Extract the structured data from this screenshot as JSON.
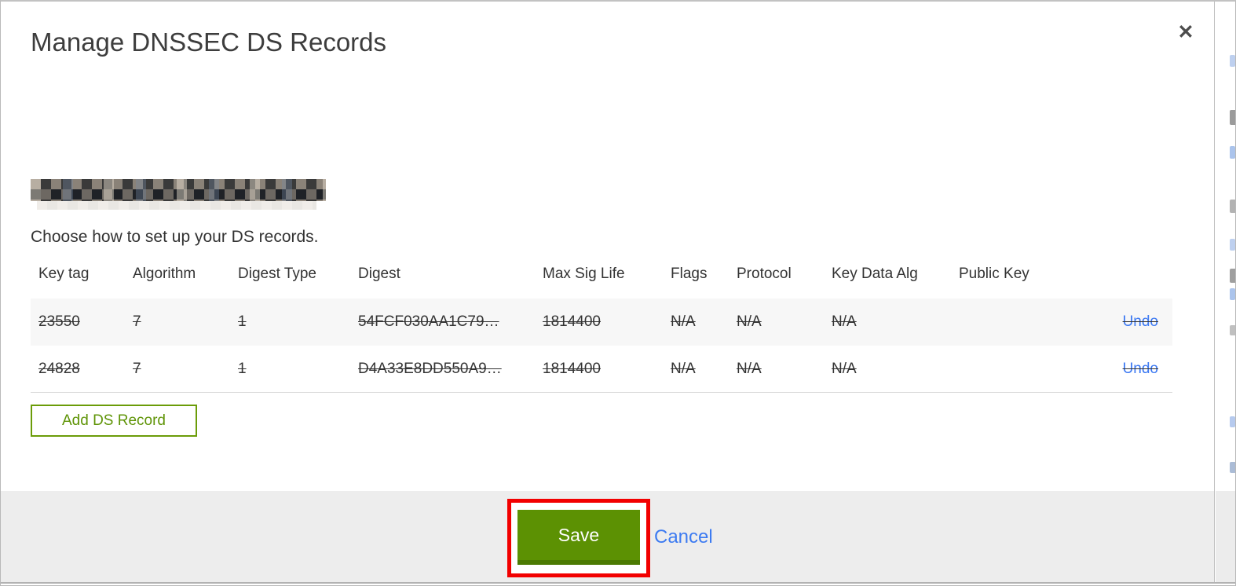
{
  "icons": {
    "close": "✕"
  },
  "modal": {
    "title": "Manage DNSSEC DS Records",
    "domain_redacted": true,
    "subtitle": "Choose how to set up your DS records.",
    "table": {
      "headers": [
        "Key tag",
        "Algorithm",
        "Digest Type",
        "Digest",
        "Max Sig Life",
        "Flags",
        "Protocol",
        "Key Data Alg",
        "Public Key"
      ],
      "rows": [
        {
          "cells": [
            "23550",
            "7",
            "1",
            "54FCF030AA1C79…",
            "1814400",
            "N/A",
            "N/A",
            "N/A",
            ""
          ],
          "struck": true,
          "action": "Undo"
        },
        {
          "cells": [
            "24828",
            "7",
            "1",
            "D4A33E8DD550A9…",
            "1814400",
            "N/A",
            "N/A",
            "N/A",
            ""
          ],
          "struck": true,
          "action": "Undo"
        }
      ]
    },
    "add_ds_record_button": "Add DS Record",
    "footer": {
      "save_label": "Save",
      "cancel_label": "Cancel"
    }
  },
  "colors": {
    "accent_green": "#5c9103",
    "accent_green_dark": "#4b7a02",
    "outline_green": "#6b9c08",
    "link_blue": "#3b78f2",
    "annotation_red": "#f20000",
    "footer_gray": "#ededed"
  }
}
